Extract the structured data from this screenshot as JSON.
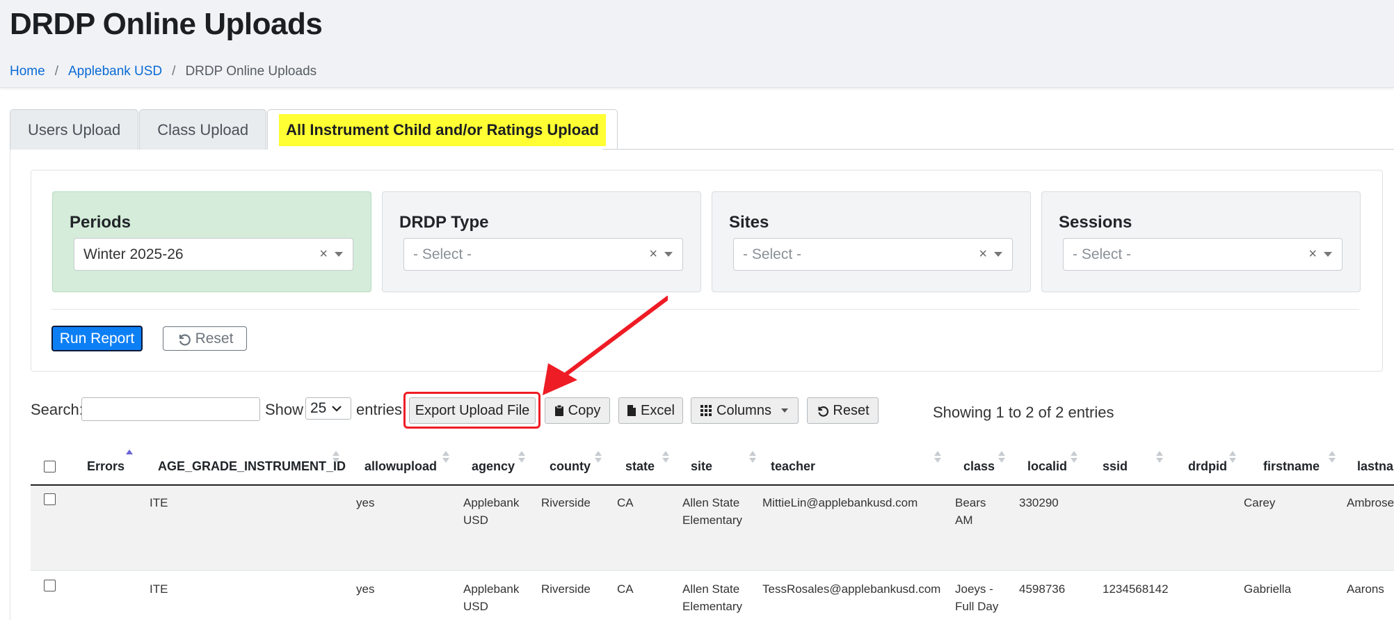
{
  "page": {
    "title": "DRDP Online Uploads",
    "breadcrumb": [
      "Home",
      "Applebank USD",
      "DRDP Online Uploads"
    ]
  },
  "tabs": [
    "Users Upload",
    "Class Upload",
    "All Instrument Child and/or Ratings Upload"
  ],
  "filters": {
    "periods": {
      "label": "Periods",
      "value": "Winter 2025-26"
    },
    "drdp_type": {
      "label": "DRDP Type",
      "placeholder": "- Select -"
    },
    "sites": {
      "label": "Sites",
      "placeholder": "- Select -"
    },
    "sessions": {
      "label": "Sessions",
      "placeholder": "- Select -"
    },
    "clear_glyph": "×"
  },
  "actions": {
    "run_report": "Run Report",
    "reset": "Reset"
  },
  "datatable": {
    "search_label": "Search:",
    "show_label": "Show",
    "page_size": "25",
    "entries_label": "entries",
    "buttons": {
      "export": "Export Upload File",
      "copy": "Copy",
      "excel": "Excel",
      "columns": "Columns",
      "reset": "Reset"
    },
    "info": "Showing 1 to 2 of 2 entries",
    "columns": [
      "Errors",
      "AGE_GRADE_INSTRUMENT_ID",
      "allowupload",
      "agency",
      "county",
      "state",
      "site",
      "teacher",
      "class",
      "localid",
      "ssid",
      "drdpid",
      "firstname",
      "lastnam"
    ],
    "rows": [
      {
        "errors": "",
        "age_grade_instrument_id": "ITE",
        "allowupload": "yes",
        "agency_1": "Applebank",
        "agency_2": "USD",
        "county": "Riverside",
        "state": "CA",
        "site_1": "Allen State",
        "site_2": "Elementary",
        "teacher": "MittieLin@applebankusd.com",
        "class_1": "Bears",
        "class_2": "AM",
        "localid": "330290",
        "ssid": "",
        "drdpid": "",
        "firstname": "Carey",
        "lastname": "Ambrose"
      },
      {
        "errors": "",
        "age_grade_instrument_id": "ITE",
        "allowupload": "yes",
        "agency_1": "Applebank",
        "agency_2": "USD",
        "county": "Riverside",
        "state": "CA",
        "site_1": "Allen State",
        "site_2": "Elementary",
        "teacher": "TessRosales@applebankusd.com",
        "class_1": "Joeys -",
        "class_2": "Full Day",
        "localid": "4598736",
        "ssid": "1234568142",
        "drdpid": "",
        "firstname": "Gabriella",
        "lastname": "Aarons"
      }
    ]
  },
  "colors": {
    "accent": "#0d7ff5",
    "tab_highlight": "#ffff33",
    "annotation": "#ee1c25",
    "periods_bg": "#d4ecd9"
  }
}
